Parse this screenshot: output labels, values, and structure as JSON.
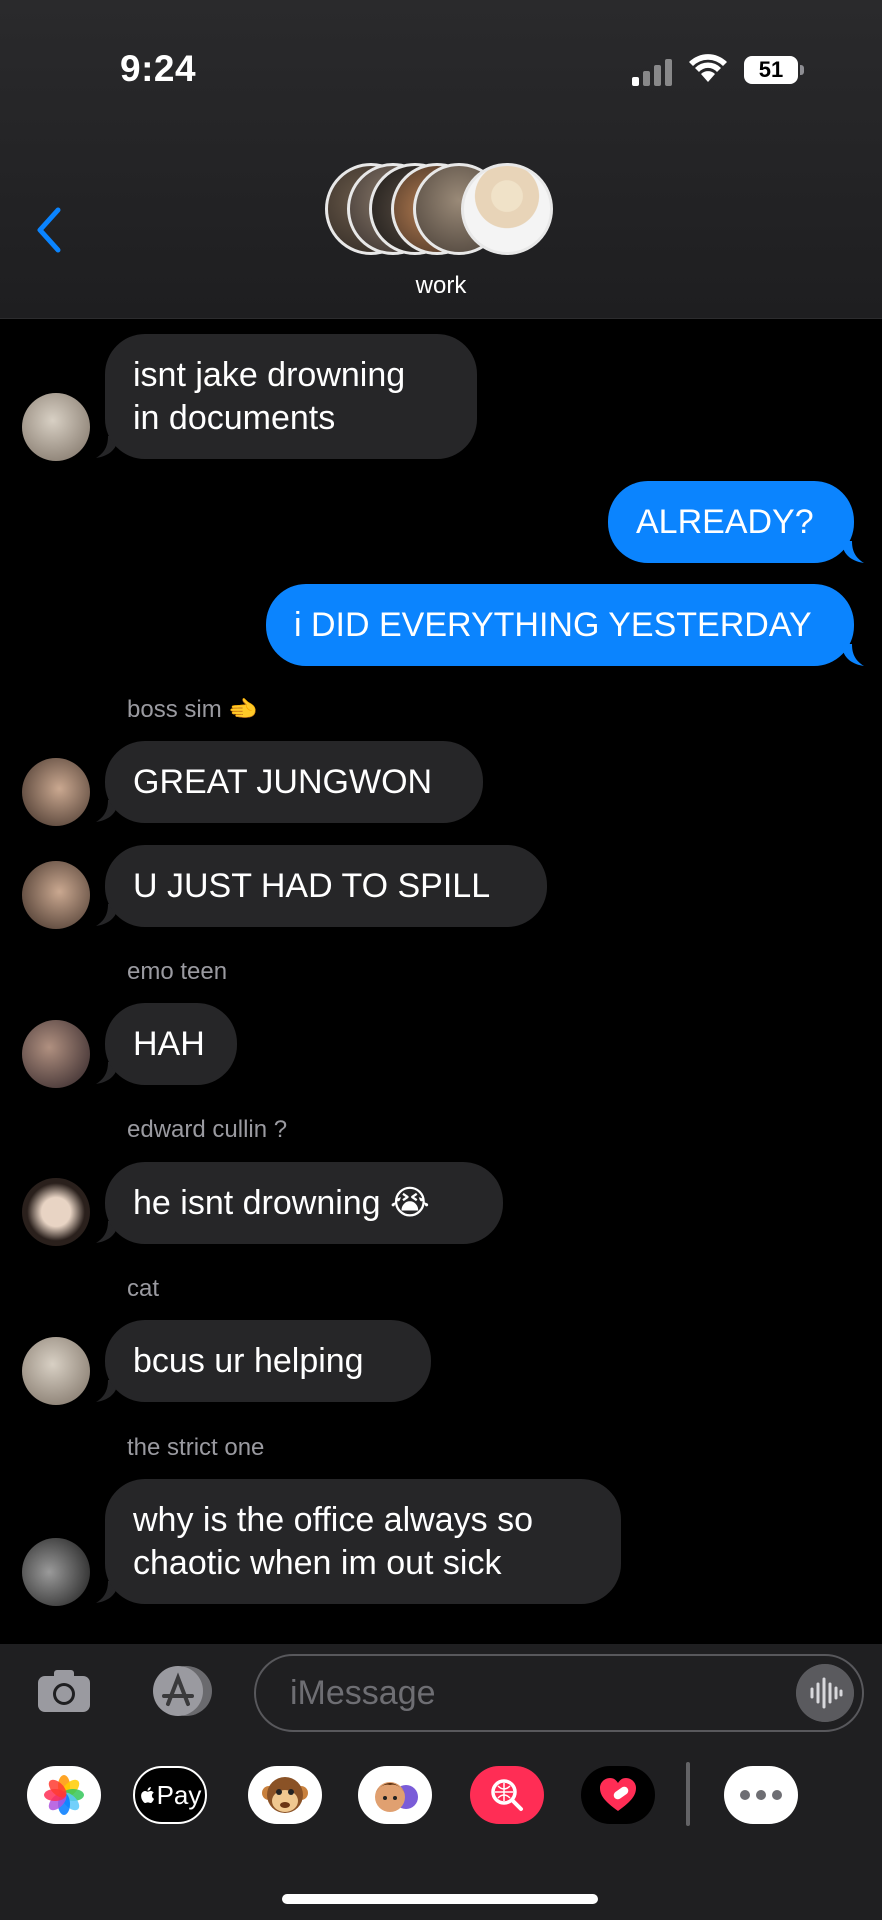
{
  "status_bar": {
    "time": "9:24",
    "battery": "51"
  },
  "conversation": {
    "name": "work"
  },
  "messages": [
    {
      "text": "isnt jake drowning\nin documents"
    },
    {
      "text": "ALREADY?"
    },
    {
      "text": "i DID EVERYTHING YESTERDAY"
    },
    {
      "sender": "boss sim 🫲"
    },
    {
      "text": "GREAT JUNGWON"
    },
    {
      "text": "U JUST HAD TO SPILL"
    },
    {
      "sender": "emo teen"
    },
    {
      "text": "HAH"
    },
    {
      "sender": "edward cullin ?"
    },
    {
      "text": "he isnt drowning 😭"
    },
    {
      "sender": "cat"
    },
    {
      "text": "bcus ur helping"
    },
    {
      "sender": "the strict one"
    },
    {
      "text": "why is the office always so\nchaotic when im out sick"
    }
  ],
  "input": {
    "placeholder": "iMessage"
  },
  "app_drawer": {
    "apple_pay_label": "Pay"
  },
  "icons": {
    "back": "chevron-left-icon",
    "camera": "camera-icon",
    "appstore": "appstore-icon",
    "mic": "audio-waveform-icon",
    "photos": "photos-icon",
    "memoji": "memoji-icon",
    "animoji": "monkey-icon",
    "search": "image-search-icon",
    "fitness": "digital-touch-icon",
    "more": "more-icon"
  },
  "colors": {
    "outgoing": "#0b84fe",
    "incoming": "#262628",
    "accent": "#0a84ff"
  }
}
